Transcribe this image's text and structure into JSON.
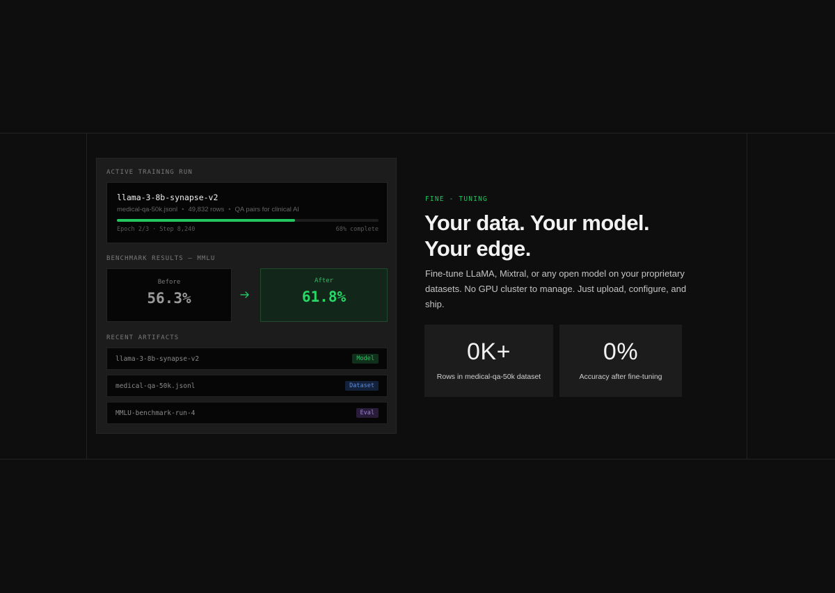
{
  "training": {
    "section_label": "ACTIVE TRAINING RUN",
    "run_name": "llama-3-8b-synapse-v2",
    "dataset_file": "medical-qa-50k.jsonl",
    "rows": "49,832 rows",
    "description": "QA pairs for clinical AI",
    "epoch": "Epoch 2/3",
    "step": "Step 8,240",
    "complete_text": "68% complete",
    "progress_fraction": 0.68
  },
  "benchmark": {
    "section_label": "BENCHMARK RESULTS — MMLU",
    "before_label": "Before",
    "before_value": "56.3%",
    "after_label": "After",
    "after_value": "61.8%"
  },
  "artifacts": {
    "section_label": "RECENT ARTIFACTS",
    "items": [
      {
        "name": "llama-3-8b-synapse-v2",
        "tag": "Model"
      },
      {
        "name": "medical-qa-50k.jsonl",
        "tag": "Dataset"
      },
      {
        "name": "MMLU-benchmark-run-4",
        "tag": "Eval"
      }
    ]
  },
  "hero": {
    "eyebrow": "FINE - TUNING",
    "headline_line1": "Your data. Your model.",
    "headline_line2": "Your edge.",
    "description": "Fine-tune LLaMA, Mixtral, or any open model on your proprietary datasets. No GPU cluster to manage. Just upload, configure, and ship."
  },
  "stats": [
    {
      "value": "0K+",
      "label": "Rows in medical-qa-50k dataset"
    },
    {
      "value": "0%",
      "label": "Accuracy after fine-tuning"
    }
  ],
  "colors": {
    "accent": "#22c55e",
    "background": "#0e0e0e",
    "panel": "#1c1c1c",
    "tag_model": "#2fbf62",
    "tag_dataset": "#5d8ee0",
    "tag_eval": "#a07fd8"
  },
  "icons": {
    "arrow": "arrow-right-icon"
  }
}
